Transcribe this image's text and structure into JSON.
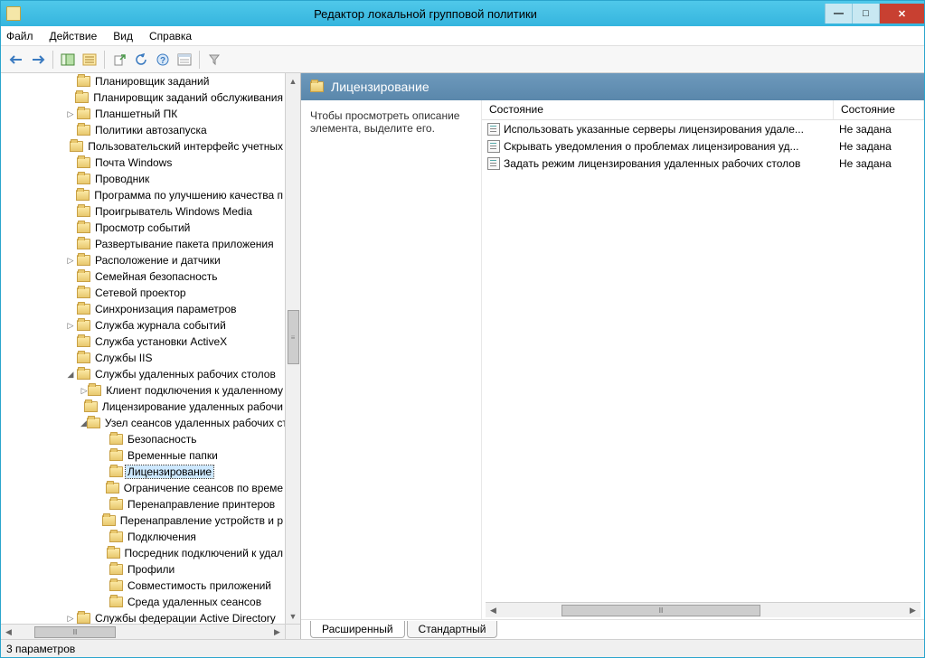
{
  "window": {
    "title": "Редактор локальной групповой политики"
  },
  "menu": {
    "file": "Файл",
    "action": "Действие",
    "view": "Вид",
    "help": "Справка"
  },
  "tree": {
    "items": [
      {
        "depth": 0,
        "exp": "",
        "label": "Планировщик заданий"
      },
      {
        "depth": 0,
        "exp": "",
        "label": "Планировщик заданий обслуживания"
      },
      {
        "depth": 0,
        "exp": "▷",
        "label": "Планшетный ПК"
      },
      {
        "depth": 0,
        "exp": "",
        "label": "Политики автозапуска"
      },
      {
        "depth": 0,
        "exp": "",
        "label": "Пользовательский интерфейс учетных"
      },
      {
        "depth": 0,
        "exp": "",
        "label": "Почта Windows"
      },
      {
        "depth": 0,
        "exp": "",
        "label": "Проводник"
      },
      {
        "depth": 0,
        "exp": "",
        "label": "Программа по улучшению качества п"
      },
      {
        "depth": 0,
        "exp": "",
        "label": "Проигрыватель Windows Media"
      },
      {
        "depth": 0,
        "exp": "",
        "label": "Просмотр событий"
      },
      {
        "depth": 0,
        "exp": "",
        "label": "Развертывание пакета приложения"
      },
      {
        "depth": 0,
        "exp": "▷",
        "label": "Расположение и датчики"
      },
      {
        "depth": 0,
        "exp": "",
        "label": "Семейная безопасность"
      },
      {
        "depth": 0,
        "exp": "",
        "label": "Сетевой проектор"
      },
      {
        "depth": 0,
        "exp": "",
        "label": "Синхронизация параметров"
      },
      {
        "depth": 0,
        "exp": "▷",
        "label": "Служба журнала событий"
      },
      {
        "depth": 0,
        "exp": "",
        "label": "Служба установки ActiveX"
      },
      {
        "depth": 0,
        "exp": "",
        "label": "Службы IIS"
      },
      {
        "depth": 0,
        "exp": "◢",
        "label": "Службы удаленных рабочих столов"
      },
      {
        "depth": 1,
        "exp": "▷",
        "label": "Клиент подключения к удаленному"
      },
      {
        "depth": 1,
        "exp": "",
        "label": "Лицензирование удаленных рабочи"
      },
      {
        "depth": 1,
        "exp": "◢",
        "label": "Узел сеансов удаленных рабочих ст"
      },
      {
        "depth": 2,
        "exp": "",
        "label": "Безопасность"
      },
      {
        "depth": 2,
        "exp": "",
        "label": "Временные папки"
      },
      {
        "depth": 2,
        "exp": "",
        "label": "Лицензирование",
        "selected": true
      },
      {
        "depth": 2,
        "exp": "",
        "label": "Ограничение сеансов по време"
      },
      {
        "depth": 2,
        "exp": "",
        "label": "Перенаправление принтеров"
      },
      {
        "depth": 2,
        "exp": "",
        "label": "Перенаправление устройств и р"
      },
      {
        "depth": 2,
        "exp": "",
        "label": "Подключения"
      },
      {
        "depth": 2,
        "exp": "",
        "label": "Посредник подключений к удал"
      },
      {
        "depth": 2,
        "exp": "",
        "label": "Профили"
      },
      {
        "depth": 2,
        "exp": "",
        "label": "Совместимость приложений"
      },
      {
        "depth": 2,
        "exp": "",
        "label": "Среда удаленных сеансов"
      },
      {
        "depth": 0,
        "exp": "▷",
        "label": "Службы федерации Active Directory"
      }
    ]
  },
  "right": {
    "header": "Лицензирование",
    "description": "Чтобы просмотреть описание элемента, выделите его.",
    "col1": "Состояние",
    "col2": "Состояние",
    "rows": [
      {
        "name": "Использовать указанные серверы лицензирования удале...",
        "state": "Не задана"
      },
      {
        "name": "Скрывать уведомления о проблемах лицензирования уд...",
        "state": "Не задана"
      },
      {
        "name": "Задать режим лицензирования удаленных рабочих столов",
        "state": "Не задана"
      }
    ],
    "tab1": "Расширенный",
    "tab2": "Стандартный"
  },
  "status": "3 параметров"
}
